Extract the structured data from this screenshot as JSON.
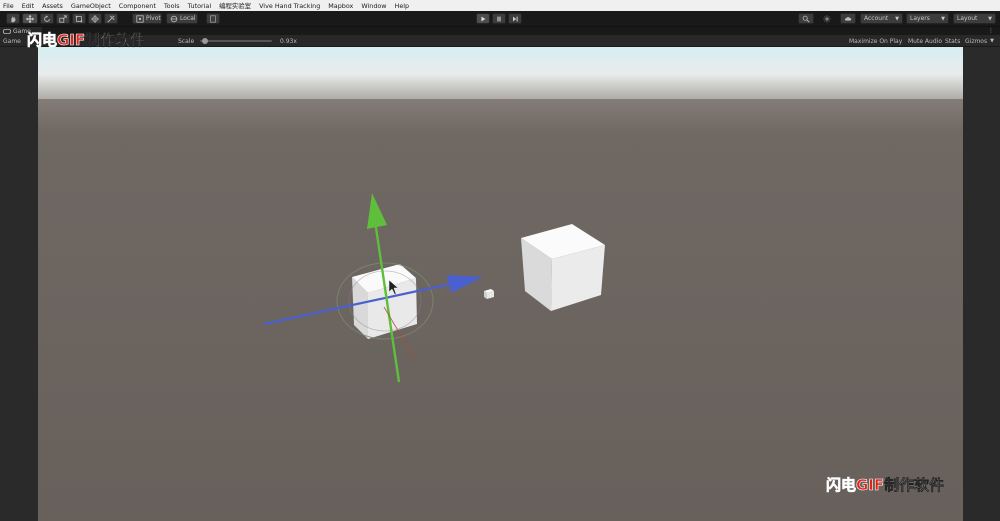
{
  "menu": [
    "File",
    "Edit",
    "Assets",
    "GameObject",
    "Component",
    "Tools",
    "Tutorial",
    "编程实验室",
    "Vive Hand Tracking",
    "Mapbox",
    "Window",
    "Help"
  ],
  "toolbar": {
    "pivot_label": "Pivot",
    "local_label": "Local",
    "account_label": "Account",
    "layers_label": "Layers",
    "layout_label": "Layout"
  },
  "tab": {
    "label": "Game",
    "menu_glyph": "⋮"
  },
  "gamebar": {
    "display_label": "Game",
    "scale_label": "Scale",
    "scale_value": "0.93x",
    "scale_fraction": 0.03,
    "maximize_label": "Maximize On Play",
    "mute_label": "Mute Audio",
    "stats_label": "Stats",
    "gizmos_label": "Gizmos"
  },
  "watermark": {
    "red_part": "闪电GIF",
    "white_part": "制作软件"
  },
  "colors": {
    "sky_top": "#cfe6ea",
    "ground": "#69625e",
    "gizmo_y": "#5fbf3c",
    "gizmo_z": "#4a5fd0",
    "gizmo_x": "#c04a3a"
  }
}
